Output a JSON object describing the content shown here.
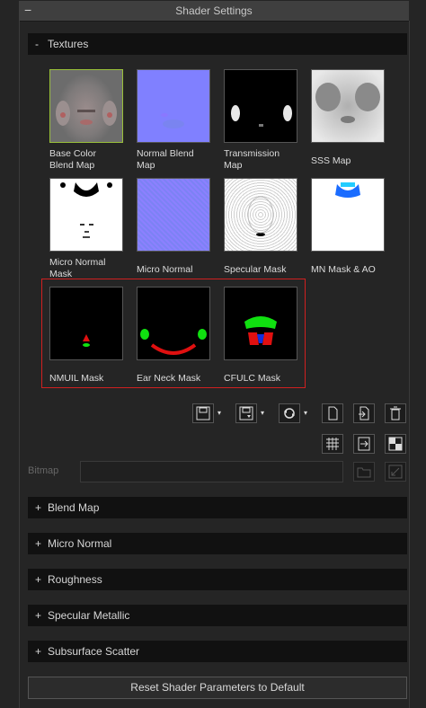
{
  "panel": {
    "title": "Shader Settings",
    "collapse_symbol": "−"
  },
  "textures": {
    "header": "Textures",
    "header_sign": "-",
    "items": [
      {
        "label": "Base Color\nBlend Map"
      },
      {
        "label": "Normal Blend\nMap"
      },
      {
        "label": "Transmission\nMap"
      },
      {
        "label": "SSS Map"
      },
      {
        "label": "Micro Normal\nMask"
      },
      {
        "label": "Micro Normal"
      },
      {
        "label": "Specular Mask"
      },
      {
        "label": "MN Mask & AO"
      },
      {
        "label": "NMUIL Mask"
      },
      {
        "label": "Ear Neck Mask"
      },
      {
        "label": "CFULC Mask"
      }
    ]
  },
  "toolbar": {
    "icons": [
      "load-icon",
      "save-icon",
      "swap-icon",
      "copy-icon",
      "import-icon",
      "delete-icon",
      "adjust-icon",
      "export-icon",
      "checker-icon"
    ],
    "dropdown_symbol": "▾"
  },
  "bitmap": {
    "label": "Bitmap",
    "value": ""
  },
  "sections": [
    {
      "sign": "+",
      "label": "Blend Map"
    },
    {
      "sign": "+",
      "label": "Micro Normal"
    },
    {
      "sign": "+",
      "label": "Roughness"
    },
    {
      "sign": "+",
      "label": "Specular Metallic"
    },
    {
      "sign": "+",
      "label": "Subsurface Scatter"
    }
  ],
  "reset_label": "Reset Shader Parameters to Default",
  "colors": {
    "selected_border": "#9ac03a",
    "highlight_box": "#d02020",
    "normal_blue": "#8080ff"
  }
}
